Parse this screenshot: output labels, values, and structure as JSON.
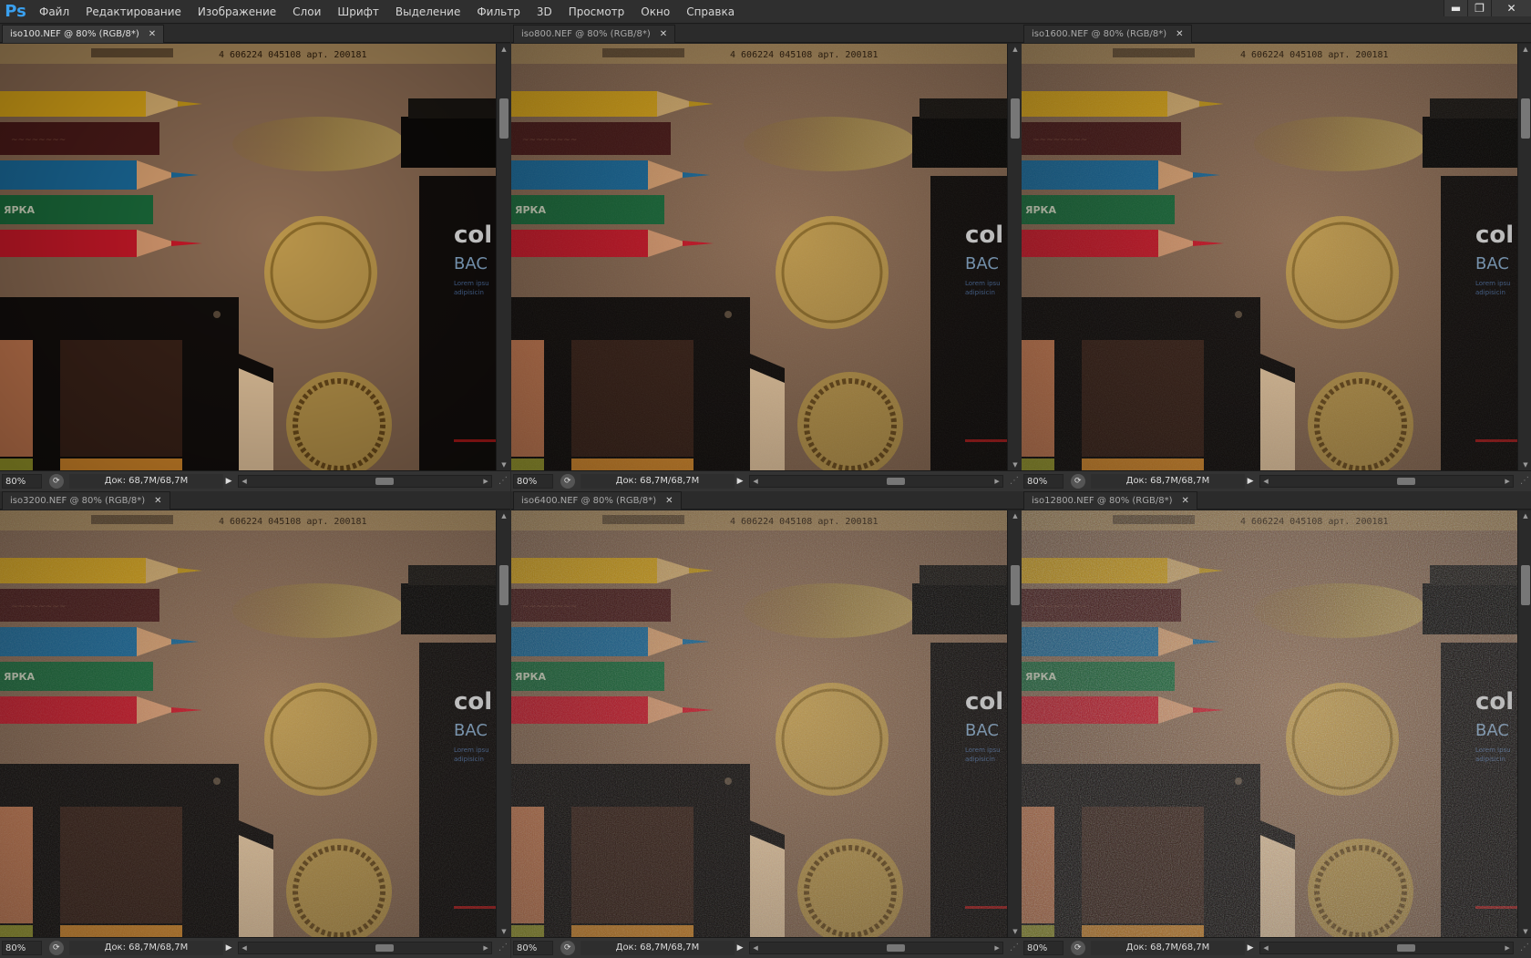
{
  "app": {
    "logo": "Ps"
  },
  "menu": [
    "Файл",
    "Редактирование",
    "Изображение",
    "Слои",
    "Шрифт",
    "Выделение",
    "Фильтр",
    "3D",
    "Просмотр",
    "Окно",
    "Справка"
  ],
  "window_controls": {
    "minimize": "▬",
    "restore": "❐",
    "close": "✕"
  },
  "documents": [
    {
      "tab": "iso100.NEF @ 80% (RGB/8*)",
      "zoom": "80%",
      "doc_info": "Док: 68,7M/68,7M",
      "active": true,
      "noise": 0.0
    },
    {
      "tab": "iso800.NEF @ 80% (RGB/8*)",
      "zoom": "80%",
      "doc_info": "Док: 68,7M/68,7M",
      "active": false,
      "noise": 0.08
    },
    {
      "tab": "iso1600.NEF @ 80% (RGB/8*)",
      "zoom": "80%",
      "doc_info": "Док: 68,7M/68,7M",
      "active": false,
      "noise": 0.12
    },
    {
      "tab": "iso3200.NEF @ 80% (RGB/8*)",
      "zoom": "80%",
      "doc_info": "Док: 68,7M/68,7M",
      "active": false,
      "noise": 0.2
    },
    {
      "tab": "iso6400.NEF @ 80% (RGB/8*)",
      "zoom": "80%",
      "doc_info": "Док: 68,7M/68,7M",
      "active": false,
      "noise": 0.32
    },
    {
      "tab": "iso12800.NEF @ 80% (RGB/8*)",
      "zoom": "80%",
      "doc_info": "Док: 68,7M/68,7M",
      "active": false,
      "noise": 0.48
    }
  ],
  "scene": {
    "barcode_text": "4 606224 045108 арт. 200181",
    "box_text_1": "col",
    "box_text_2": "BAC",
    "box_text_3": "Lorem ipsu",
    "box_text_4": "adipisicin",
    "pencil_brand": "ЯРКА",
    "colors": {
      "background": "#8a6a52",
      "yellow_pencil": "#d8a418",
      "red_brown_pencil": "#4a1a18",
      "blue_pencil": "#1a6a9a",
      "green_pencil": "#1a6a3a",
      "red_pencil": "#c81828",
      "coin": "#b8944a",
      "card": "#120e0c",
      "swatch_dark": "#3a2218",
      "swatch_orange": "#c87a50",
      "accent_blue": "#3aa0ef"
    }
  }
}
